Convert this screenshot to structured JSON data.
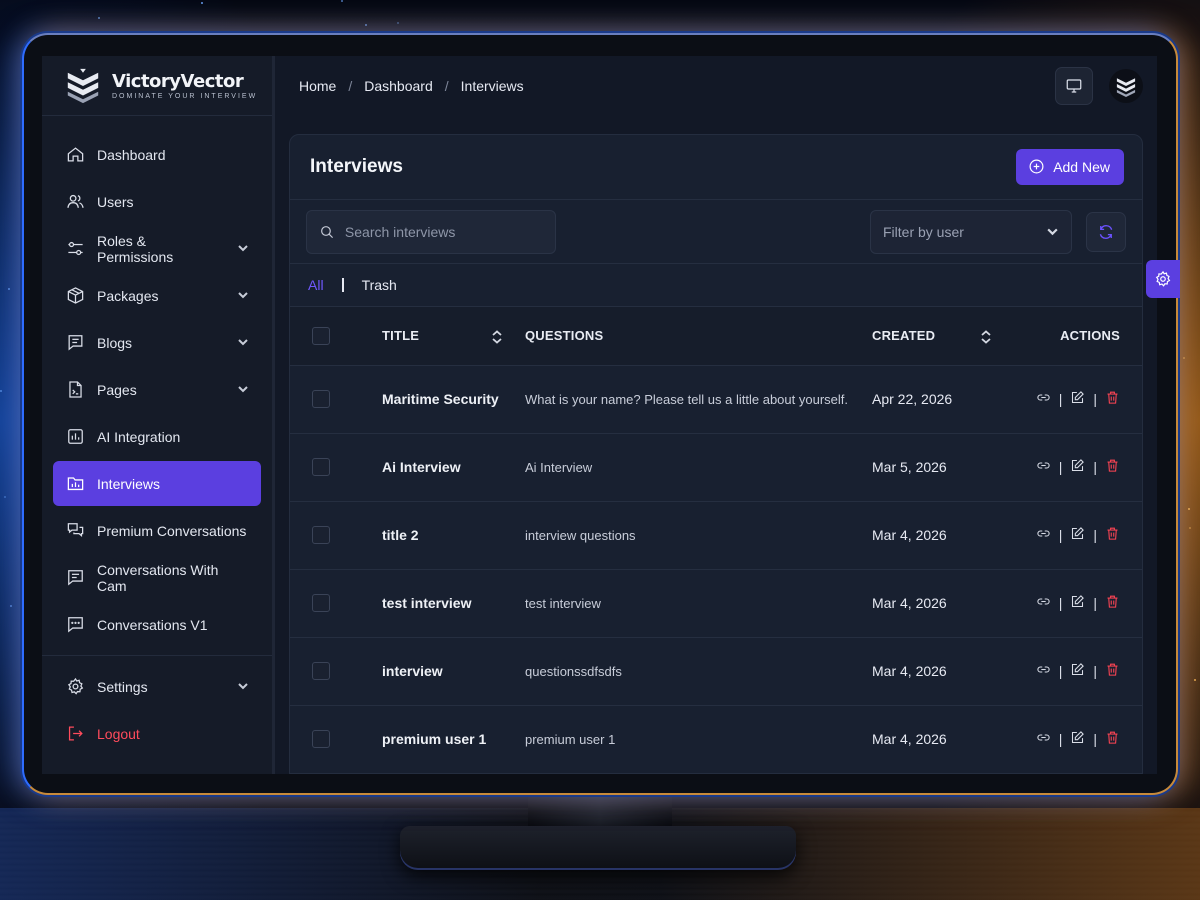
{
  "brand": {
    "name": "VictoryVector",
    "tagline": "DOMINATE YOUR INTERVIEW"
  },
  "sidebar": {
    "items": [
      {
        "label": "Dashboard",
        "icon": "home-icon",
        "has_submenu": false,
        "active": false
      },
      {
        "label": "Users",
        "icon": "users-icon",
        "has_submenu": false,
        "active": false
      },
      {
        "label": "Roles & Permissions",
        "icon": "sliders-icon",
        "has_submenu": true,
        "active": false
      },
      {
        "label": "Packages",
        "icon": "package-icon",
        "has_submenu": true,
        "active": false
      },
      {
        "label": "Blogs",
        "icon": "blog-icon",
        "has_submenu": true,
        "active": false
      },
      {
        "label": "Pages",
        "icon": "page-icon",
        "has_submenu": true,
        "active": false
      },
      {
        "label": "AI Integration",
        "icon": "chart-icon",
        "has_submenu": false,
        "active": false
      },
      {
        "label": "Interviews",
        "icon": "folder-chart-icon",
        "has_submenu": false,
        "active": true
      },
      {
        "label": "Premium Conversations",
        "icon": "chat-bubbles-icon",
        "has_submenu": false,
        "active": false
      },
      {
        "label": "Conversations With Cam",
        "icon": "message-square-icon",
        "has_submenu": false,
        "active": false
      },
      {
        "label": "Conversations V1",
        "icon": "message-dots-icon",
        "has_submenu": false,
        "active": false
      }
    ],
    "settings": {
      "label": "Settings",
      "icon": "gear-icon"
    },
    "logout": {
      "label": "Logout",
      "icon": "logout-icon",
      "color": "#ff4b5c"
    }
  },
  "header": {
    "breadcrumb": [
      "Home",
      "Dashboard",
      "Interviews"
    ],
    "separator": "/"
  },
  "panel": {
    "title": "Interviews",
    "add_button": "Add New",
    "search_placeholder": "Search interviews",
    "filter_placeholder": "Filter by user",
    "tabs": [
      {
        "label": "All",
        "active": true
      },
      {
        "label": "Trash",
        "active": false
      }
    ],
    "columns": {
      "title": "TITLE",
      "questions": "QUESTIONS",
      "created": "CREATED",
      "actions": "ACTIONS"
    },
    "action_separator": "|",
    "rows": [
      {
        "title": "Maritime Security",
        "questions": "What is your name? Please tell us a little about yourself. Than",
        "created": "Apr 22, 2026"
      },
      {
        "title": "Ai Interview",
        "questions": "Ai Interview",
        "created": "Mar 5, 2026"
      },
      {
        "title": "title 2",
        "questions": "interview questions",
        "created": "Mar 4, 2026"
      },
      {
        "title": "test interview",
        "questions": "test interview",
        "created": "Mar 4, 2026"
      },
      {
        "title": "interview",
        "questions": "questionssdfsdfs",
        "created": "Mar 4, 2026"
      },
      {
        "title": "premium user 1",
        "questions": "premium user 1",
        "created": "Mar 4, 2026"
      }
    ]
  },
  "colors": {
    "accent": "#5b3fe0",
    "accent_text": "#7058ff",
    "danger": "#ff4454",
    "sidebar_bg": "#151b28",
    "panel_bg": "#182030"
  }
}
